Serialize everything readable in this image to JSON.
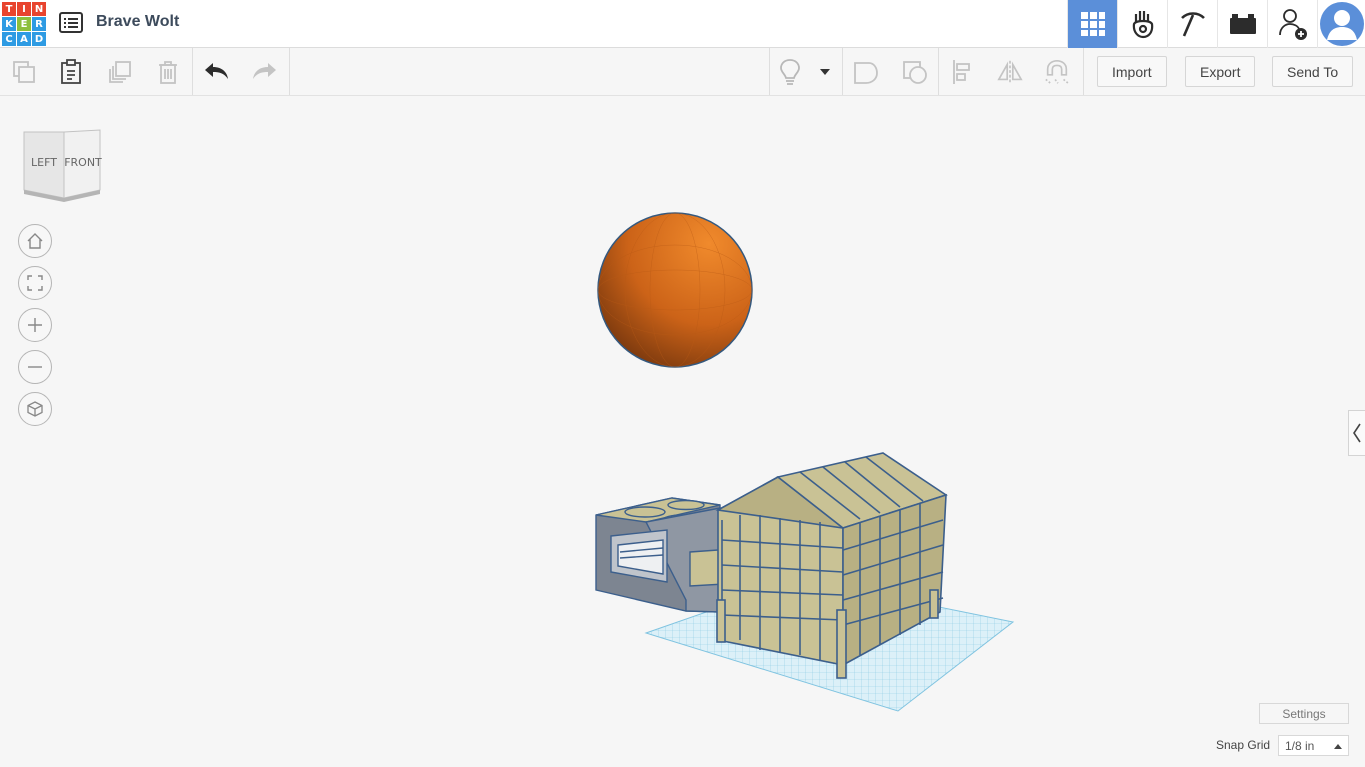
{
  "header": {
    "logo_letters": [
      "T",
      "I",
      "N",
      "K",
      "E",
      "R",
      "C",
      "A",
      "D"
    ],
    "logo_colors": [
      "#e8442e",
      "#e8442e",
      "#e8442e",
      "#2e9be3",
      "#8dbf3c",
      "#2e9be3",
      "#2e9be3",
      "#2e9be3",
      "#2e9be3"
    ],
    "design_name": "Brave Wolt",
    "icons": [
      "grid-view-icon",
      "hand-tinker-icon",
      "pickaxe-icon",
      "brick-icon",
      "add-user-icon",
      "profile-avatar-icon"
    ],
    "accent": "#5b8fd9"
  },
  "toolbar": {
    "import_label": "Import",
    "export_label": "Export",
    "send_to_label": "Send To"
  },
  "viewcube": {
    "left_label": "LEFT",
    "front_label": "FRONT"
  },
  "footer": {
    "settings_label": "Settings",
    "snap_grid_label": "Snap Grid",
    "snap_grid_value": "1/8 in"
  },
  "colors": {
    "sphere": "#e07a22",
    "model_fill": "#c9c295",
    "model_outline": "#3c5f8c",
    "workplane": "#9fd4ec"
  }
}
